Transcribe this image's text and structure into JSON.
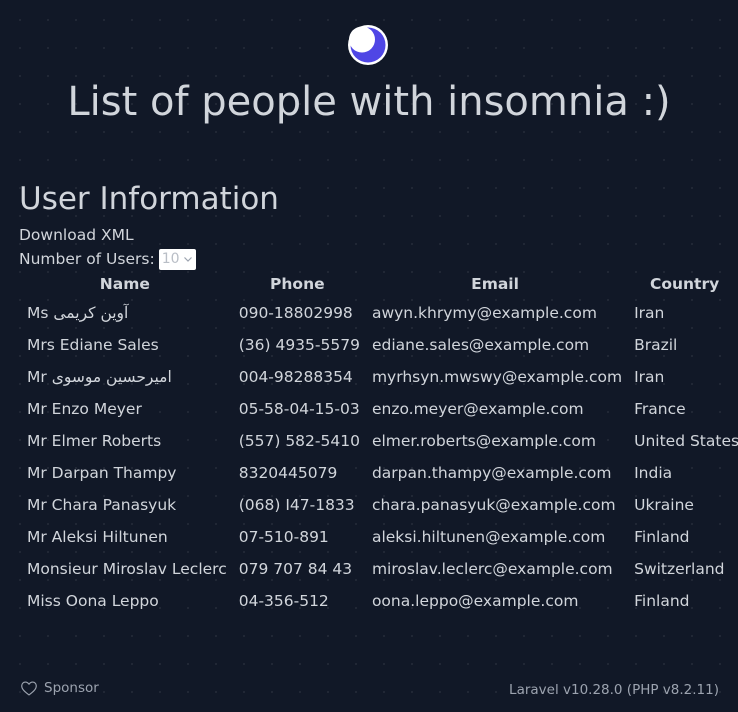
{
  "header": {
    "title": "List of people with insomnia :)",
    "logo_icon": "moon-icon"
  },
  "section": {
    "title": "User Information",
    "download_label": "Download XML",
    "users_count_label": "Number of Users:",
    "users_count_selected": "10"
  },
  "table": {
    "headers": [
      "Name",
      "Phone",
      "Email",
      "Country"
    ],
    "rows": [
      {
        "name": "Ms آوین کریمی",
        "phone": "090-18802998",
        "email": "awyn.khrymy@example.com",
        "country": "Iran"
      },
      {
        "name": "Mrs Ediane Sales",
        "phone": "(36) 4935-5579",
        "email": "ediane.sales@example.com",
        "country": "Brazil"
      },
      {
        "name": "Mr امیرحسین موسوی",
        "phone": "004-98288354",
        "email": "myrhsyn.mwswy@example.com",
        "country": "Iran"
      },
      {
        "name": "Mr Enzo Meyer",
        "phone": "05-58-04-15-03",
        "email": "enzo.meyer@example.com",
        "country": "France"
      },
      {
        "name": "Mr Elmer Roberts",
        "phone": "(557) 582-5410",
        "email": "elmer.roberts@example.com",
        "country": "United States"
      },
      {
        "name": "Mr Darpan Thampy",
        "phone": "8320445079",
        "email": "darpan.thampy@example.com",
        "country": "India"
      },
      {
        "name": "Mr Chara Panasyuk",
        "phone": "(068) I47-1833",
        "email": "chara.panasyuk@example.com",
        "country": "Ukraine"
      },
      {
        "name": "Mr Aleksi Hiltunen",
        "phone": "07-510-891",
        "email": "aleksi.hiltunen@example.com",
        "country": "Finland"
      },
      {
        "name": "Monsieur Miroslav Leclerc",
        "phone": "079 707 84 43",
        "email": "miroslav.leclerc@example.com",
        "country": "Switzerland"
      },
      {
        "name": "Miss Oona Leppo",
        "phone": "04-356-512",
        "email": "oona.leppo@example.com",
        "country": "Finland"
      }
    ]
  },
  "footer": {
    "sponsor_label": "Sponsor",
    "sponsor_icon": "heart-icon",
    "version": "Laravel v10.28.0 (PHP v8.2.11)"
  },
  "colors": {
    "background": "#111827",
    "text": "#d1d5db",
    "muted_text": "#9ca3af",
    "logo_purple": "#4f46e5"
  }
}
